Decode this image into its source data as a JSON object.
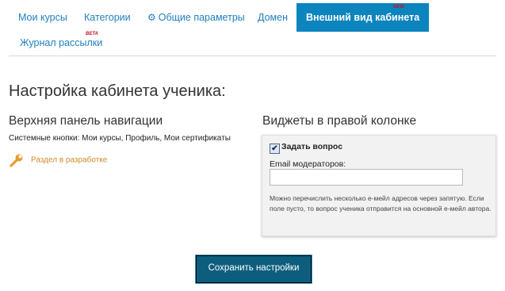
{
  "nav": {
    "tabs": [
      {
        "label": "Мои курсы"
      },
      {
        "label": "Категории"
      },
      {
        "label": "Общие параметры"
      },
      {
        "label": "Домен"
      },
      {
        "label": "Внешний вид кабинета",
        "badge": "NEW"
      },
      {
        "label": "Журнал рассылки",
        "badge": "BETA"
      }
    ],
    "active_color": "#0c84bd"
  },
  "page": {
    "title": "Настройка кабинета ученика:"
  },
  "left": {
    "heading": "Верхняя панель навигации",
    "system_buttons": "Системные кнопки: Мои курсы, Профиль, Мои сертификаты",
    "dev_note": "Раздел в разработке",
    "dev_icon": "wrench-icon",
    "dev_color": "#cf8a27"
  },
  "right": {
    "heading": "Виджеты в правой колонке",
    "checkbox_label": "Задать вопрос",
    "checkbox_checked": true,
    "email_label": "Email модераторов:",
    "email_value": "",
    "help": "Можно перечислить несколько е-мейл адресов через запятую. Если поле пусто, то вопрос ученика отправится на основной е-мейл автора."
  },
  "actions": {
    "save_label": "Сохранить настройки"
  }
}
